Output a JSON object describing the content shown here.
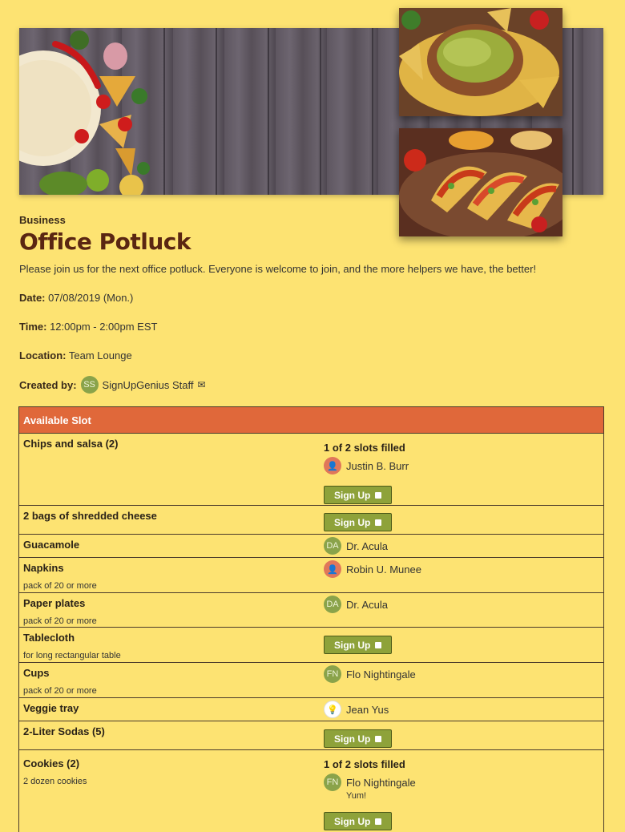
{
  "header": {
    "category": "Business",
    "title": "Office Potluck",
    "description": "Please join us for the next office potluck. Everyone is welcome to join, and the more helpers we have, the better!"
  },
  "details": {
    "date_label": "Date:",
    "date_value": "07/08/2019 (Mon.)",
    "time_label": "Time:",
    "time_value": "12:00pm - 2:00pm EST",
    "location_label": "Location:",
    "location_value": "Team Lounge",
    "created_label": "Created by:",
    "creator_initials": "SS",
    "creator_name": "SignUpGenius Staff",
    "creator_icon": "envelope-icon"
  },
  "table": {
    "header": "Available Slot",
    "signup_label": "Sign Up",
    "rows": [
      {
        "name": "Chips and salsa (2)",
        "note": "",
        "filled": "1 of 2 slots filled",
        "person": "Justin B. Burr",
        "initials": "",
        "signup": true
      },
      {
        "name": "2 bags of shredded cheese",
        "note": "",
        "signup": true
      },
      {
        "name": "Guacamole",
        "note": "",
        "person": "Dr. Acula",
        "initials": "DA"
      },
      {
        "name": "Napkins",
        "note": "pack of 20 or more",
        "person": "Robin U. Munee",
        "initials": ""
      },
      {
        "name": "Paper plates",
        "note": "pack of 20 or more",
        "person": "Dr. Acula",
        "initials": "DA"
      },
      {
        "name": "Tablecloth",
        "note": "for long rectangular table",
        "signup": true
      },
      {
        "name": "Cups",
        "note": "pack of 20 or more",
        "person": "Flo Nightingale",
        "initials": "FN"
      },
      {
        "name": "Veggie tray",
        "note": "",
        "person": "Jean Yus",
        "initials": ""
      },
      {
        "name": "2-Liter Sodas (5)",
        "note": "",
        "signup": true
      },
      {
        "name": "Cookies (2)",
        "note": "2 dozen cookies",
        "filled": "1 of 2 slots filled",
        "person": "Flo Nightingale",
        "initials": "FN",
        "comment": "Yum!",
        "signup": true
      }
    ]
  },
  "colors": {
    "background": "#fde372",
    "header_bar": "#e0683a",
    "title": "#5a2612",
    "button": "#8ea23a"
  }
}
